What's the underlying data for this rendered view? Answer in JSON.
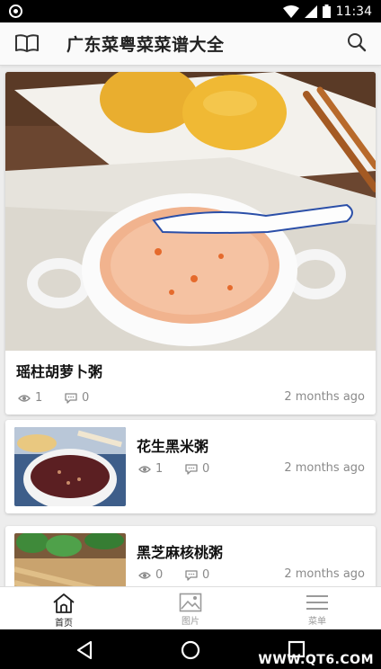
{
  "status_bar": {
    "time": "11:34",
    "icons": [
      "circle-notification-icon",
      "wifi-icon",
      "signal-icon",
      "battery-icon"
    ]
  },
  "app_bar": {
    "title": "广东菜粤菜菜谱大全",
    "left_icon": "book-icon",
    "right_icon": "search-icon"
  },
  "recipes": [
    {
      "title": "瑶柱胡萝卜粥",
      "views": "1",
      "comments": "0",
      "time": "2 months ago"
    },
    {
      "title": "花生黑米粥",
      "views": "1",
      "comments": "0",
      "time": "2 months ago"
    },
    {
      "title": "黑芝麻核桃粥",
      "views": "0",
      "comments": "0",
      "time": "2 months ago"
    }
  ],
  "bottom_nav": [
    {
      "label": "首页",
      "icon": "home-icon",
      "active": true
    },
    {
      "label": "图片",
      "icon": "image-icon",
      "active": false
    },
    {
      "label": "菜单",
      "icon": "menu-icon",
      "active": false
    }
  ],
  "watermark": "WWW.QT6.COM",
  "colors": {
    "app_bar_bg": "#fafafa",
    "background": "#ededed",
    "card_bg": "#ffffff",
    "muted_text": "#8a8a8a"
  }
}
